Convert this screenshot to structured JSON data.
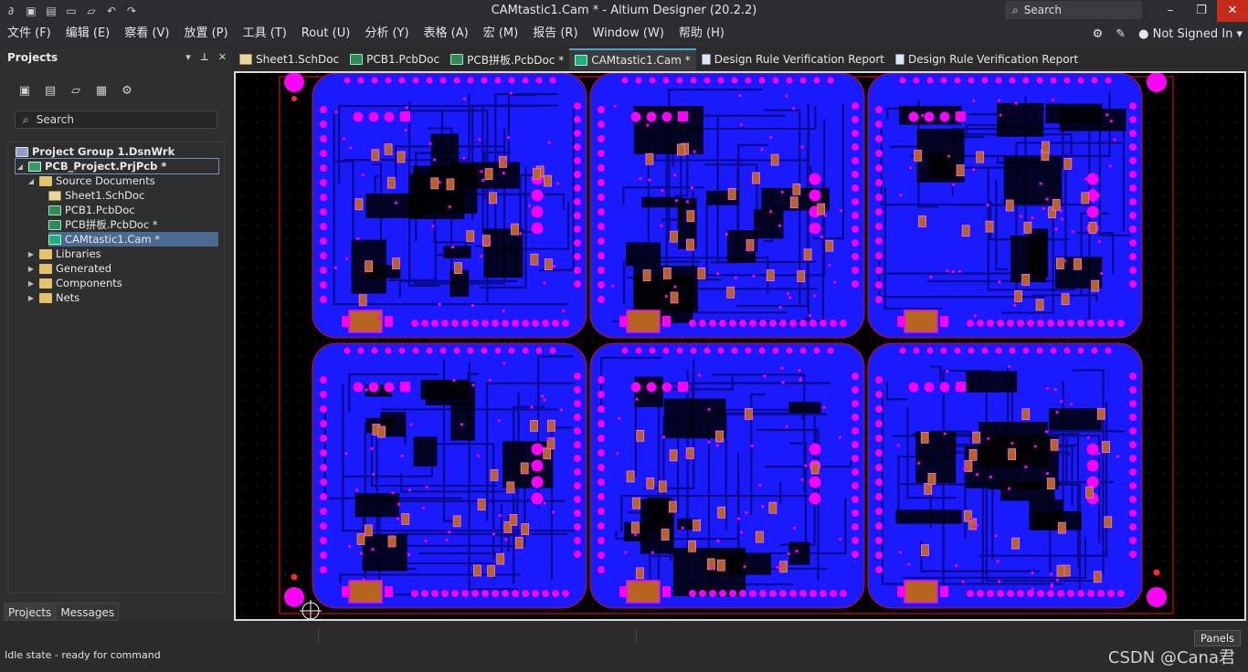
{
  "titlebar": {
    "title": "CAMtastic1.Cam * - Altium Designer (20.2.2)",
    "search_placeholder": "Search",
    "quick_access": [
      "app-logo-icon",
      "save-icon",
      "save-all-icon",
      "open-icon",
      "open-project-icon",
      "undo-icon",
      "redo-icon"
    ]
  },
  "menu": {
    "items": [
      "文件 (F)",
      "编辑 (E)",
      "察看 (V)",
      "放置 (P)",
      "工具 (T)",
      "Rout (U)",
      "分析 (Y)",
      "表格 (A)",
      "宏 (M)",
      "报告 (R)",
      "Window (W)",
      "帮助 (H)"
    ],
    "account": "Not Signed In"
  },
  "projects_panel": {
    "title": "Projects",
    "search_placeholder": "Search",
    "tree": {
      "group": "Project Group 1.DsnWrk",
      "project": "PCB_Project.PrjPcb *",
      "source_documents": "Source Documents",
      "docs": [
        "Sheet1.SchDoc",
        "PCB1.PcbDoc",
        "PCB拼板.PcbDoc *",
        "CAMtastic1.Cam *"
      ],
      "folders": [
        "Libraries",
        "Generated",
        "Components",
        "Nets"
      ]
    },
    "tabs": [
      "Projects",
      "Messages"
    ]
  },
  "doc_tabs": [
    "Sheet1.SchDoc",
    "PCB1.PcbDoc",
    "PCB拼板.PcbDoc *",
    "CAMtastic1.Cam *",
    "Design Rule Verification Report",
    "Design Rule Verification Report"
  ],
  "active_tab": "CAMtastic1.Cam *",
  "canvas": {
    "panel_grid": {
      "rows": 2,
      "cols": 3
    },
    "colors": {
      "background": "#000000",
      "copper": "#1a1aff",
      "traces": "#0a0a8a",
      "pads": "#ff00ff",
      "outline": "#cc1111",
      "components": "#b5651d"
    }
  },
  "status": {
    "text": "Idle state - ready for command",
    "panels_button": "Panels",
    "watermark": "CSDN @Cana君"
  }
}
